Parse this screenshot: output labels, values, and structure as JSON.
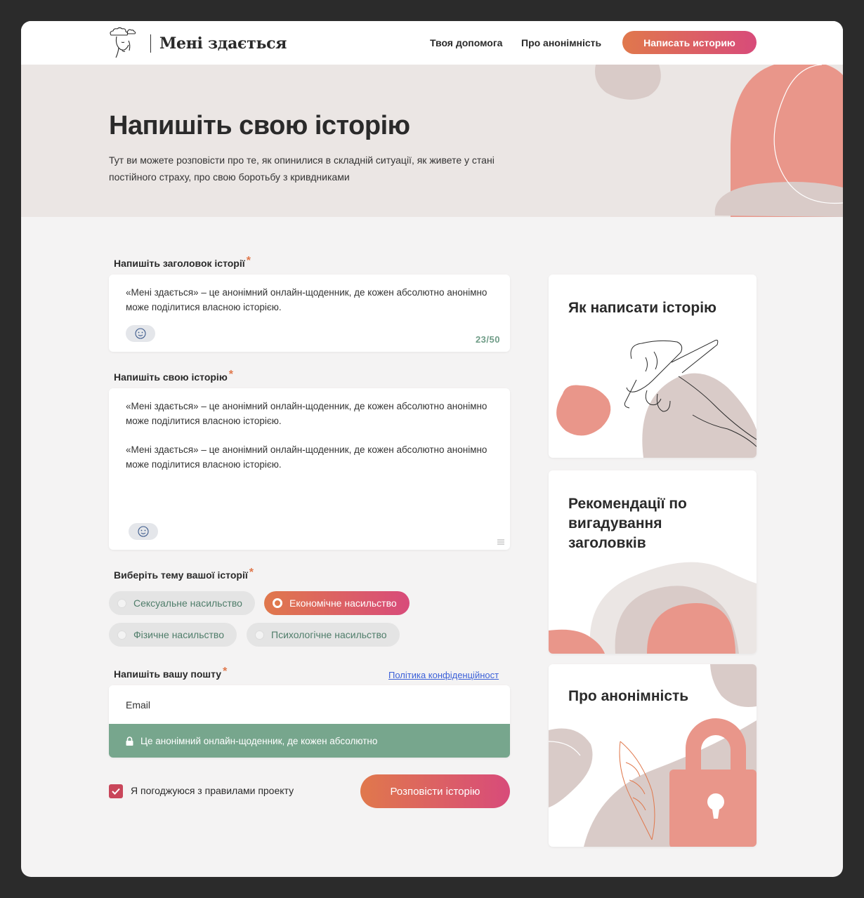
{
  "header": {
    "logo_text": "Мені здається",
    "nav": [
      "Твоя допомога",
      "Про анонімність"
    ],
    "cta": "Написать историю"
  },
  "hero": {
    "title": "Напишіть свою історію",
    "description": "Тут ви можете розповісти про те, як опинилися в складній ситуації, як живете у стані постійного страху, про свою боротьбу з кривдниками"
  },
  "form": {
    "title_label": "Напишіть заголовок історії",
    "title_value": "«Мені здається» – це анонімний онлайн-щоденник, де кожен абсолютно анонімно може поділитися власною історією.",
    "title_counter": "23/50",
    "story_label": "Напишіть свою історію",
    "story_paragraphs": [
      "«Мені здається» – це анонімний онлайн-щоденник, де кожен абсолютно анонімно може поділитися власною історією.",
      "«Мені здається» – це анонімний онлайн-щоденник, де кожен абсолютно анонімно може поділитися власною історією."
    ],
    "topic_label": "Виберіть тему вашої історії",
    "topics": [
      {
        "label": "Сексуальне насильство",
        "selected": false
      },
      {
        "label": "Економічне насильство",
        "selected": true
      },
      {
        "label": "Фізичне насильство",
        "selected": false
      },
      {
        "label": "Психологічне насильство",
        "selected": false
      }
    ],
    "email_label": "Напишіть вашу пошту",
    "privacy_link": "Політика конфіденційност",
    "email_placeholder": "Email",
    "email_note": "Це анонімний онлайн-щоденник, де кожен абсолютно",
    "agree_label": "Я погоджуюся з правилами проекту",
    "agree_checked": true,
    "submit": "Розповісти історію",
    "required_mark": "*"
  },
  "sidebar": {
    "cards": [
      {
        "title": "Як написати історію"
      },
      {
        "title": "Рекомендації по вигадування заголовків"
      },
      {
        "title": "Про анонімність"
      }
    ]
  },
  "colors": {
    "accent_start": "#e0784c",
    "accent_end": "#d84b7a",
    "green": "#77a68d",
    "peach": "#e9968a",
    "beige": "#d9cbc8"
  }
}
